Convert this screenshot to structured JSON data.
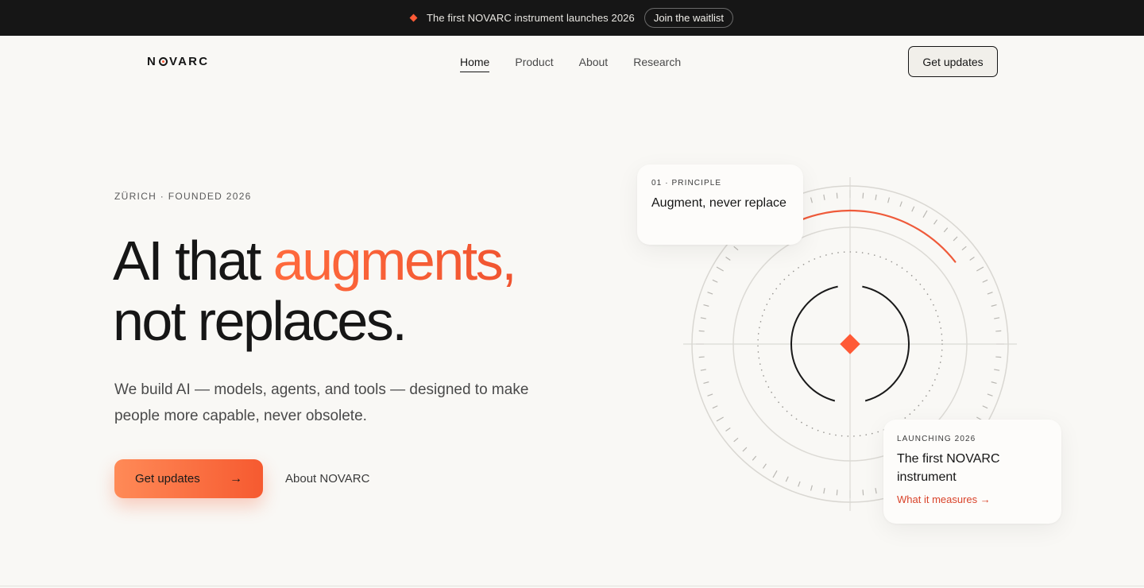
{
  "announcement": {
    "text": "The first NOVARC instrument launches 2026",
    "cta_label": "Join the waitlist"
  },
  "nav": {
    "logo_text_before": "N",
    "logo_text_after": "VARC",
    "links": [
      "Home",
      "Product",
      "About",
      "Research"
    ],
    "active": "Home",
    "cta_label": "Get updates"
  },
  "hero": {
    "eyebrow": "ZÜRICH · FOUNDED 2026",
    "headline_part1": "AI that ",
    "headline_accent": "augments,",
    "headline_part2": "not replaces.",
    "subcopy": "We build AI — models, agents, and tools — designed to make people more capable, never obsolete.",
    "primary_cta": "Get updates",
    "primary_cta_arrow": "→",
    "secondary_cta": "About NOVARC"
  },
  "cards": {
    "principle": {
      "kicker": "01 · PRINCIPLE",
      "title": "Augment, never replace"
    },
    "launch": {
      "kicker": "LAUNCHING 2026",
      "title": "The first NOVARC instrument",
      "link": "What it measures →"
    }
  },
  "colors": {
    "accent": "#ff5a36",
    "ink": "#161616",
    "background": "#f9f8f5",
    "topbar": "#161616"
  }
}
